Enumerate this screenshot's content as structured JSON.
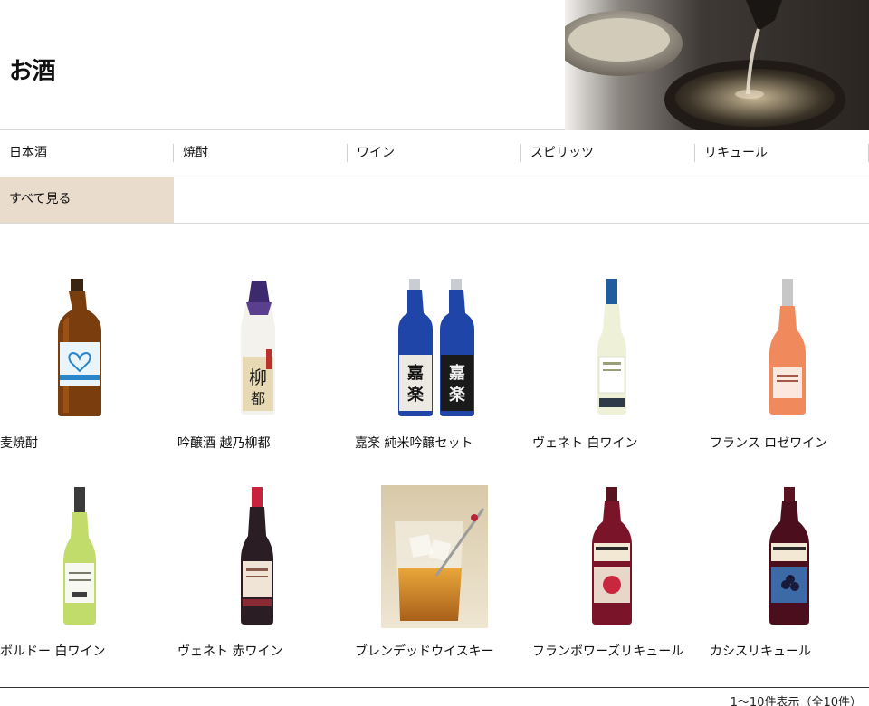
{
  "page": {
    "title": "お酒"
  },
  "nav": {
    "categories": [
      "日本酒",
      "焼酎",
      "ワイン",
      "スピリッツ",
      "リキュール"
    ],
    "all_label": "すべて見る"
  },
  "products": [
    {
      "name": "麦焼酎"
    },
    {
      "name": "吟醸酒 越乃柳都"
    },
    {
      "name": "嘉楽 純米吟醸セット"
    },
    {
      "name": "ヴェネト 白ワイン"
    },
    {
      "name": "フランス ロゼワイン"
    },
    {
      "name": "ボルドー 白ワイン"
    },
    {
      "name": "ヴェネト 赤ワイン"
    },
    {
      "name": "ブレンデッドウイスキー"
    },
    {
      "name": "フランボワーズリキュール"
    },
    {
      "name": "カシスリキュール"
    }
  ],
  "footer": {
    "count": "1〜10件表示（全10件）"
  },
  "colors": {
    "accent_tab": "#eadccd",
    "rule": "#d8d8d8"
  }
}
